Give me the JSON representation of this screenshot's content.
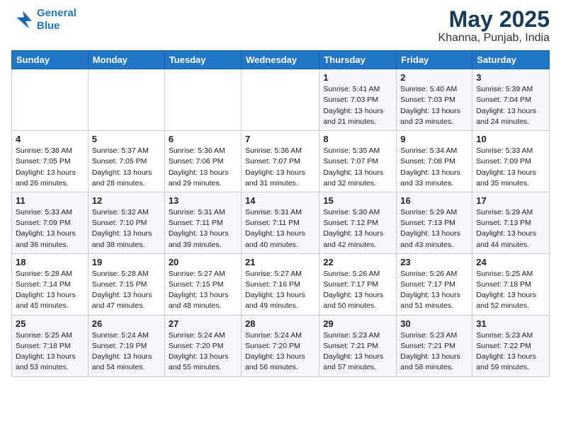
{
  "header": {
    "logo_line1": "General",
    "logo_line2": "Blue",
    "month": "May 2025",
    "location": "Khanna, Punjab, India"
  },
  "weekdays": [
    "Sunday",
    "Monday",
    "Tuesday",
    "Wednesday",
    "Thursday",
    "Friday",
    "Saturday"
  ],
  "weeks": [
    [
      {
        "day": "",
        "content": ""
      },
      {
        "day": "",
        "content": ""
      },
      {
        "day": "",
        "content": ""
      },
      {
        "day": "",
        "content": ""
      },
      {
        "day": "1",
        "content": "Sunrise: 5:41 AM\nSunset: 7:03 PM\nDaylight: 13 hours\nand 21 minutes."
      },
      {
        "day": "2",
        "content": "Sunrise: 5:40 AM\nSunset: 7:03 PM\nDaylight: 13 hours\nand 23 minutes."
      },
      {
        "day": "3",
        "content": "Sunrise: 5:39 AM\nSunset: 7:04 PM\nDaylight: 13 hours\nand 24 minutes."
      }
    ],
    [
      {
        "day": "4",
        "content": "Sunrise: 5:38 AM\nSunset: 7:05 PM\nDaylight: 13 hours\nand 26 minutes."
      },
      {
        "day": "5",
        "content": "Sunrise: 5:37 AM\nSunset: 7:05 PM\nDaylight: 13 hours\nand 28 minutes."
      },
      {
        "day": "6",
        "content": "Sunrise: 5:36 AM\nSunset: 7:06 PM\nDaylight: 13 hours\nand 29 minutes."
      },
      {
        "day": "7",
        "content": "Sunrise: 5:36 AM\nSunset: 7:07 PM\nDaylight: 13 hours\nand 31 minutes."
      },
      {
        "day": "8",
        "content": "Sunrise: 5:35 AM\nSunset: 7:07 PM\nDaylight: 13 hours\nand 32 minutes."
      },
      {
        "day": "9",
        "content": "Sunrise: 5:34 AM\nSunset: 7:08 PM\nDaylight: 13 hours\nand 33 minutes."
      },
      {
        "day": "10",
        "content": "Sunrise: 5:33 AM\nSunset: 7:09 PM\nDaylight: 13 hours\nand 35 minutes."
      }
    ],
    [
      {
        "day": "11",
        "content": "Sunrise: 5:33 AM\nSunset: 7:09 PM\nDaylight: 13 hours\nand 36 minutes."
      },
      {
        "day": "12",
        "content": "Sunrise: 5:32 AM\nSunset: 7:10 PM\nDaylight: 13 hours\nand 38 minutes."
      },
      {
        "day": "13",
        "content": "Sunrise: 5:31 AM\nSunset: 7:11 PM\nDaylight: 13 hours\nand 39 minutes."
      },
      {
        "day": "14",
        "content": "Sunrise: 5:31 AM\nSunset: 7:11 PM\nDaylight: 13 hours\nand 40 minutes."
      },
      {
        "day": "15",
        "content": "Sunrise: 5:30 AM\nSunset: 7:12 PM\nDaylight: 13 hours\nand 42 minutes."
      },
      {
        "day": "16",
        "content": "Sunrise: 5:29 AM\nSunset: 7:13 PM\nDaylight: 13 hours\nand 43 minutes."
      },
      {
        "day": "17",
        "content": "Sunrise: 5:29 AM\nSunset: 7:13 PM\nDaylight: 13 hours\nand 44 minutes."
      }
    ],
    [
      {
        "day": "18",
        "content": "Sunrise: 5:28 AM\nSunset: 7:14 PM\nDaylight: 13 hours\nand 45 minutes."
      },
      {
        "day": "19",
        "content": "Sunrise: 5:28 AM\nSunset: 7:15 PM\nDaylight: 13 hours\nand 47 minutes."
      },
      {
        "day": "20",
        "content": "Sunrise: 5:27 AM\nSunset: 7:15 PM\nDaylight: 13 hours\nand 48 minutes."
      },
      {
        "day": "21",
        "content": "Sunrise: 5:27 AM\nSunset: 7:16 PM\nDaylight: 13 hours\nand 49 minutes."
      },
      {
        "day": "22",
        "content": "Sunrise: 5:26 AM\nSunset: 7:17 PM\nDaylight: 13 hours\nand 50 minutes."
      },
      {
        "day": "23",
        "content": "Sunrise: 5:26 AM\nSunset: 7:17 PM\nDaylight: 13 hours\nand 51 minutes."
      },
      {
        "day": "24",
        "content": "Sunrise: 5:25 AM\nSunset: 7:18 PM\nDaylight: 13 hours\nand 52 minutes."
      }
    ],
    [
      {
        "day": "25",
        "content": "Sunrise: 5:25 AM\nSunset: 7:18 PM\nDaylight: 13 hours\nand 53 minutes."
      },
      {
        "day": "26",
        "content": "Sunrise: 5:24 AM\nSunset: 7:19 PM\nDaylight: 13 hours\nand 54 minutes."
      },
      {
        "day": "27",
        "content": "Sunrise: 5:24 AM\nSunset: 7:20 PM\nDaylight: 13 hours\nand 55 minutes."
      },
      {
        "day": "28",
        "content": "Sunrise: 5:24 AM\nSunset: 7:20 PM\nDaylight: 13 hours\nand 56 minutes."
      },
      {
        "day": "29",
        "content": "Sunrise: 5:23 AM\nSunset: 7:21 PM\nDaylight: 13 hours\nand 57 minutes."
      },
      {
        "day": "30",
        "content": "Sunrise: 5:23 AM\nSunset: 7:21 PM\nDaylight: 13 hours\nand 58 minutes."
      },
      {
        "day": "31",
        "content": "Sunrise: 5:23 AM\nSunset: 7:22 PM\nDaylight: 13 hours\nand 59 minutes."
      }
    ]
  ]
}
